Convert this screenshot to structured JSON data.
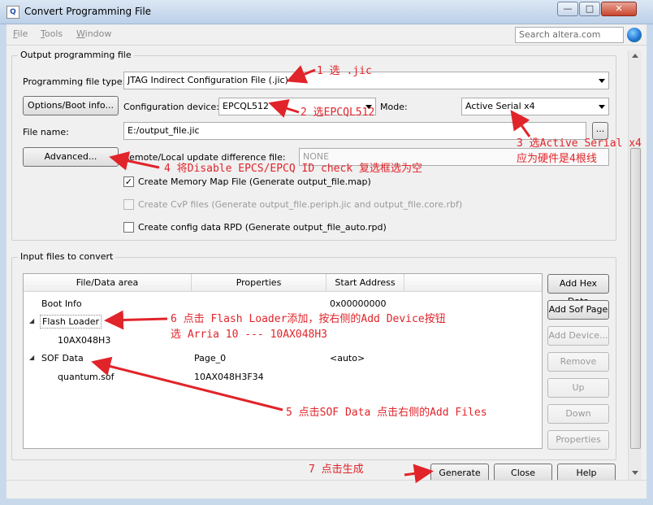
{
  "window": {
    "title": "Convert Programming File",
    "app_icon": "quartus-app-icon",
    "controls": [
      "minimize",
      "maximize",
      "close"
    ],
    "minimize_glyph": "—",
    "maximize_glyph": "□",
    "close_glyph": "✕"
  },
  "menu": {
    "items": [
      {
        "label": "File",
        "accel": "F",
        "rest": "ile"
      },
      {
        "label": "Tools",
        "accel": "T",
        "rest": "ools"
      },
      {
        "label": "Window",
        "accel": "W",
        "rest": "indow"
      }
    ],
    "search_placeholder": "Search altera.com"
  },
  "output": {
    "group_title": "Output programming file",
    "file_type_label": "Programming file type:",
    "file_type_value": "JTAG Indirect Configuration File (.jic)",
    "options_button": "Options/Boot info...",
    "config_device_label": "Configuration device:",
    "config_device_value": "EPCQL512",
    "mode_label": "Mode:",
    "mode_value": "Active Serial x4",
    "file_name_label": "File name:",
    "file_name_value": "E:/output_file.jic",
    "browse_button": "...",
    "advanced_button": "Advanced...",
    "remote_label": "Remote/Local update difference file:",
    "remote_value": "NONE",
    "checkboxes": [
      {
        "label": "Create Memory Map File (Generate output_file.map)",
        "checked": true,
        "enabled": true
      },
      {
        "label": "Create CvP files (Generate output_file.periph.jic and output_file.core.rbf)",
        "checked": false,
        "enabled": false
      },
      {
        "label": "Create config data RPD (Generate output_file_auto.rpd)",
        "checked": false,
        "enabled": true
      }
    ]
  },
  "input": {
    "group_title": "Input files to convert",
    "columns": [
      "File/Data area",
      "Properties",
      "Start Address"
    ],
    "rows": [
      {
        "indent": 0,
        "expander": "",
        "name": "Boot Info",
        "properties": "",
        "address": "0x00000000"
      },
      {
        "indent": 0,
        "expander": "◢",
        "name": "Flash Loader",
        "properties": "",
        "address": ""
      },
      {
        "indent": 1,
        "expander": "",
        "name": "10AX048H3",
        "properties": "",
        "address": ""
      },
      {
        "indent": 0,
        "expander": "◢",
        "name": "SOF Data",
        "properties": "Page_0",
        "address": "<auto>"
      },
      {
        "indent": 1,
        "expander": "",
        "name": "quantum.sof",
        "properties": "10AX048H3F34",
        "address": ""
      }
    ],
    "side_buttons": [
      {
        "label": "Add Hex Data",
        "enabled": true
      },
      {
        "label": "Add Sof Page",
        "enabled": true
      },
      {
        "label": "Add Device...",
        "enabled": false
      },
      {
        "label": "Remove",
        "enabled": false
      },
      {
        "label": "Up",
        "enabled": false
      },
      {
        "label": "Down",
        "enabled": false
      },
      {
        "label": "Properties",
        "enabled": false
      }
    ]
  },
  "footer": {
    "generate": "Generate",
    "close": "Close",
    "help": "Help"
  },
  "annotations": {
    "a1": "1 选 .jic",
    "a2": "2 选EPCQL512",
    "a3_line1": "3 选Active Serial x4",
    "a3_line2": "应为硬件是4根线",
    "a4": "4 将Disable EPCS/EPCQ ID check 复选框选为空",
    "a5": "5 点击SOF Data 点击右侧的Add Files",
    "a6_line1": "6 点击 Flash Loader添加，按右侧的Add Device按钮",
    "a6_line2": "选 Arria 10 --- 10AX048H3",
    "a7": "7 点击生成",
    "color": "#e1242a"
  }
}
